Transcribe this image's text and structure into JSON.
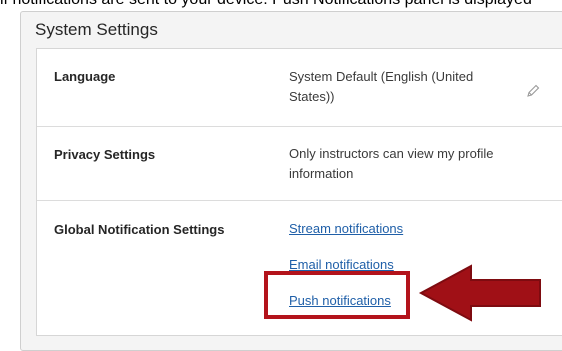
{
  "top_caption": "if notifications are sent to your device. Push Notifications panel is displayed",
  "panel": {
    "title": "System Settings"
  },
  "rows": [
    {
      "label": "Language",
      "value": "System Default (English (United States))"
    },
    {
      "label": "Privacy Settings",
      "value": "Only instructors can view my profile information"
    },
    {
      "label": "Global Notification Settings"
    }
  ],
  "notification_links": [
    "Stream notifications",
    "Email notifications",
    "Push notifications"
  ],
  "icons": {
    "edit": "pencil-icon",
    "callout": "arrow-left-icon"
  },
  "colors": {
    "highlight": "#b3131b",
    "link": "#1f5fa8"
  }
}
